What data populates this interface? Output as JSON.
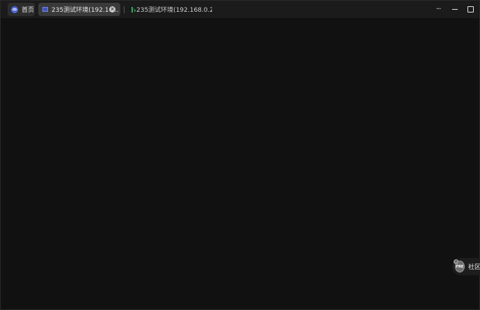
{
  "tabs": [
    {
      "label": "首页",
      "icon": "eye-logo-icon",
      "active": false
    },
    {
      "label": "235测试环境(192.16...",
      "icon": "remote-desktop-icon",
      "active": true,
      "close": "×"
    },
    {
      "label": "235测试环境(192.168.0.2...",
      "icon": "terminal-icon",
      "active": false
    }
  ],
  "window_controls": {
    "more": "···"
  },
  "community": {
    "logo_text": "FRE",
    "label": "社区",
    "close": "×"
  },
  "colors": {
    "background": "#111111",
    "titlebar": "#1b1b1b",
    "active_tab": "#3a3a3a",
    "accent": "#4f6bd8",
    "terminal": "#2fae5f"
  }
}
